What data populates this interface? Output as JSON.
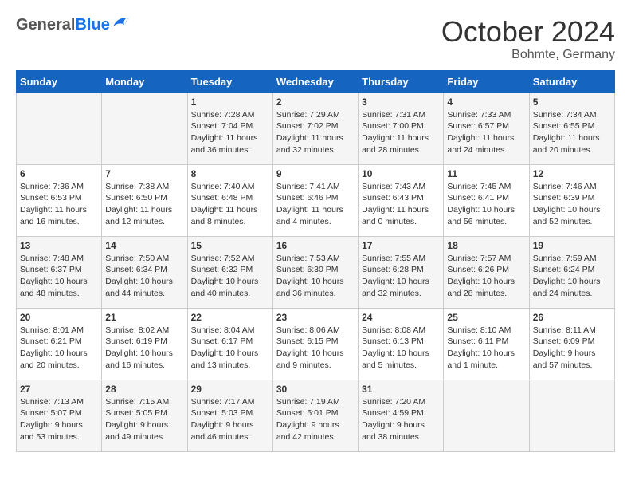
{
  "header": {
    "logo_general": "General",
    "logo_blue": "Blue",
    "month": "October 2024",
    "location": "Bohmte, Germany"
  },
  "weekdays": [
    "Sunday",
    "Monday",
    "Tuesday",
    "Wednesday",
    "Thursday",
    "Friday",
    "Saturday"
  ],
  "weeks": [
    [
      {
        "day": "",
        "content": ""
      },
      {
        "day": "",
        "content": ""
      },
      {
        "day": "1",
        "content": "Sunrise: 7:28 AM\nSunset: 7:04 PM\nDaylight: 11 hours and 36 minutes."
      },
      {
        "day": "2",
        "content": "Sunrise: 7:29 AM\nSunset: 7:02 PM\nDaylight: 11 hours and 32 minutes."
      },
      {
        "day": "3",
        "content": "Sunrise: 7:31 AM\nSunset: 7:00 PM\nDaylight: 11 hours and 28 minutes."
      },
      {
        "day": "4",
        "content": "Sunrise: 7:33 AM\nSunset: 6:57 PM\nDaylight: 11 hours and 24 minutes."
      },
      {
        "day": "5",
        "content": "Sunrise: 7:34 AM\nSunset: 6:55 PM\nDaylight: 11 hours and 20 minutes."
      }
    ],
    [
      {
        "day": "6",
        "content": "Sunrise: 7:36 AM\nSunset: 6:53 PM\nDaylight: 11 hours and 16 minutes."
      },
      {
        "day": "7",
        "content": "Sunrise: 7:38 AM\nSunset: 6:50 PM\nDaylight: 11 hours and 12 minutes."
      },
      {
        "day": "8",
        "content": "Sunrise: 7:40 AM\nSunset: 6:48 PM\nDaylight: 11 hours and 8 minutes."
      },
      {
        "day": "9",
        "content": "Sunrise: 7:41 AM\nSunset: 6:46 PM\nDaylight: 11 hours and 4 minutes."
      },
      {
        "day": "10",
        "content": "Sunrise: 7:43 AM\nSunset: 6:43 PM\nDaylight: 11 hours and 0 minutes."
      },
      {
        "day": "11",
        "content": "Sunrise: 7:45 AM\nSunset: 6:41 PM\nDaylight: 10 hours and 56 minutes."
      },
      {
        "day": "12",
        "content": "Sunrise: 7:46 AM\nSunset: 6:39 PM\nDaylight: 10 hours and 52 minutes."
      }
    ],
    [
      {
        "day": "13",
        "content": "Sunrise: 7:48 AM\nSunset: 6:37 PM\nDaylight: 10 hours and 48 minutes."
      },
      {
        "day": "14",
        "content": "Sunrise: 7:50 AM\nSunset: 6:34 PM\nDaylight: 10 hours and 44 minutes."
      },
      {
        "day": "15",
        "content": "Sunrise: 7:52 AM\nSunset: 6:32 PM\nDaylight: 10 hours and 40 minutes."
      },
      {
        "day": "16",
        "content": "Sunrise: 7:53 AM\nSunset: 6:30 PM\nDaylight: 10 hours and 36 minutes."
      },
      {
        "day": "17",
        "content": "Sunrise: 7:55 AM\nSunset: 6:28 PM\nDaylight: 10 hours and 32 minutes."
      },
      {
        "day": "18",
        "content": "Sunrise: 7:57 AM\nSunset: 6:26 PM\nDaylight: 10 hours and 28 minutes."
      },
      {
        "day": "19",
        "content": "Sunrise: 7:59 AM\nSunset: 6:24 PM\nDaylight: 10 hours and 24 minutes."
      }
    ],
    [
      {
        "day": "20",
        "content": "Sunrise: 8:01 AM\nSunset: 6:21 PM\nDaylight: 10 hours and 20 minutes."
      },
      {
        "day": "21",
        "content": "Sunrise: 8:02 AM\nSunset: 6:19 PM\nDaylight: 10 hours and 16 minutes."
      },
      {
        "day": "22",
        "content": "Sunrise: 8:04 AM\nSunset: 6:17 PM\nDaylight: 10 hours and 13 minutes."
      },
      {
        "day": "23",
        "content": "Sunrise: 8:06 AM\nSunset: 6:15 PM\nDaylight: 10 hours and 9 minutes."
      },
      {
        "day": "24",
        "content": "Sunrise: 8:08 AM\nSunset: 6:13 PM\nDaylight: 10 hours and 5 minutes."
      },
      {
        "day": "25",
        "content": "Sunrise: 8:10 AM\nSunset: 6:11 PM\nDaylight: 10 hours and 1 minute."
      },
      {
        "day": "26",
        "content": "Sunrise: 8:11 AM\nSunset: 6:09 PM\nDaylight: 9 hours and 57 minutes."
      }
    ],
    [
      {
        "day": "27",
        "content": "Sunrise: 7:13 AM\nSunset: 5:07 PM\nDaylight: 9 hours and 53 minutes."
      },
      {
        "day": "28",
        "content": "Sunrise: 7:15 AM\nSunset: 5:05 PM\nDaylight: 9 hours and 49 minutes."
      },
      {
        "day": "29",
        "content": "Sunrise: 7:17 AM\nSunset: 5:03 PM\nDaylight: 9 hours and 46 minutes."
      },
      {
        "day": "30",
        "content": "Sunrise: 7:19 AM\nSunset: 5:01 PM\nDaylight: 9 hours and 42 minutes."
      },
      {
        "day": "31",
        "content": "Sunrise: 7:20 AM\nSunset: 4:59 PM\nDaylight: 9 hours and 38 minutes."
      },
      {
        "day": "",
        "content": ""
      },
      {
        "day": "",
        "content": ""
      }
    ]
  ]
}
